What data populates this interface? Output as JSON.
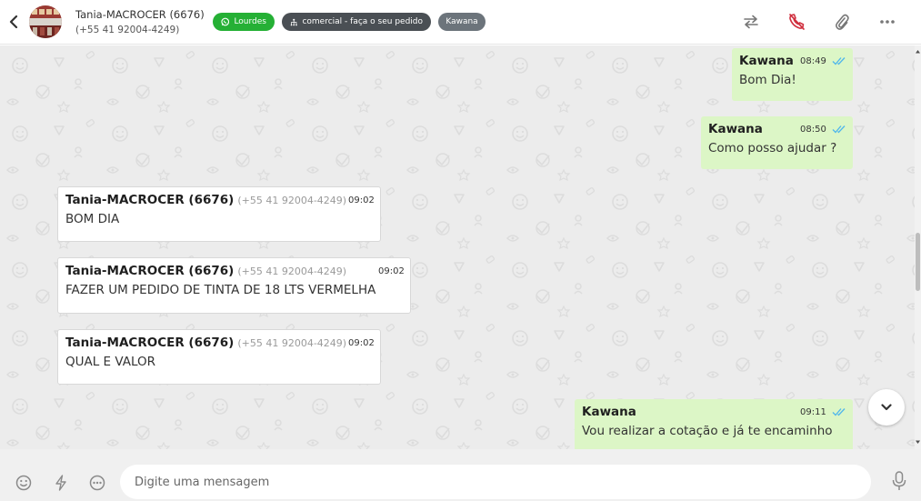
{
  "header": {
    "contact_name": "Tania-MACROCER (6676)",
    "contact_phone": "(+55 41 92004-4249)",
    "tags": [
      {
        "label": "Lourdes",
        "color": "#25b035",
        "icon": "whatsapp-icon"
      },
      {
        "label": "comercial - faça o seu pedido",
        "color": "#4a4f54",
        "icon": "sitemap-icon"
      },
      {
        "label": "Kawana",
        "color": "#6c747b"
      }
    ],
    "actions": [
      "transfer-icon",
      "end-call-icon",
      "attachment-icon",
      "more-options-icon"
    ]
  },
  "messages": [
    {
      "direction": "out",
      "sender": "Kawana",
      "time": "08:49",
      "text": "Bom Dia!",
      "status": "read"
    },
    {
      "direction": "out",
      "sender": "Kawana",
      "time": "08:50",
      "text": "Como posso ajudar ?",
      "status": "read"
    },
    {
      "direction": "in",
      "sender": "Tania-MACROCER (6676)",
      "phone": "(+55 41 92004-4249)",
      "time": "09:02",
      "text": "BOM DIA"
    },
    {
      "direction": "in",
      "sender": "Tania-MACROCER (6676)",
      "phone": "(+55 41 92004-4249)",
      "time": "09:02",
      "text": "FAZER UM PEDIDO DE TINTA DE 18 LTS VERMELHA"
    },
    {
      "direction": "in",
      "sender": "Tania-MACROCER (6676)",
      "phone": "(+55 41 92004-4249)",
      "time": "09:02",
      "text": "QUAL E VALOR"
    },
    {
      "direction": "out",
      "sender": "Kawana",
      "time": "09:11",
      "text": "Vou realizar a cotação e já te encaminho",
      "status": "read"
    }
  ],
  "composer": {
    "placeholder": "Digite uma mensagem",
    "value": ""
  },
  "colors": {
    "outgoing_bubble": "#dcf6c6",
    "incoming_bubble": "#ffffff",
    "read_ticks": "#4fb6ec",
    "end_call": "#d0303f"
  }
}
